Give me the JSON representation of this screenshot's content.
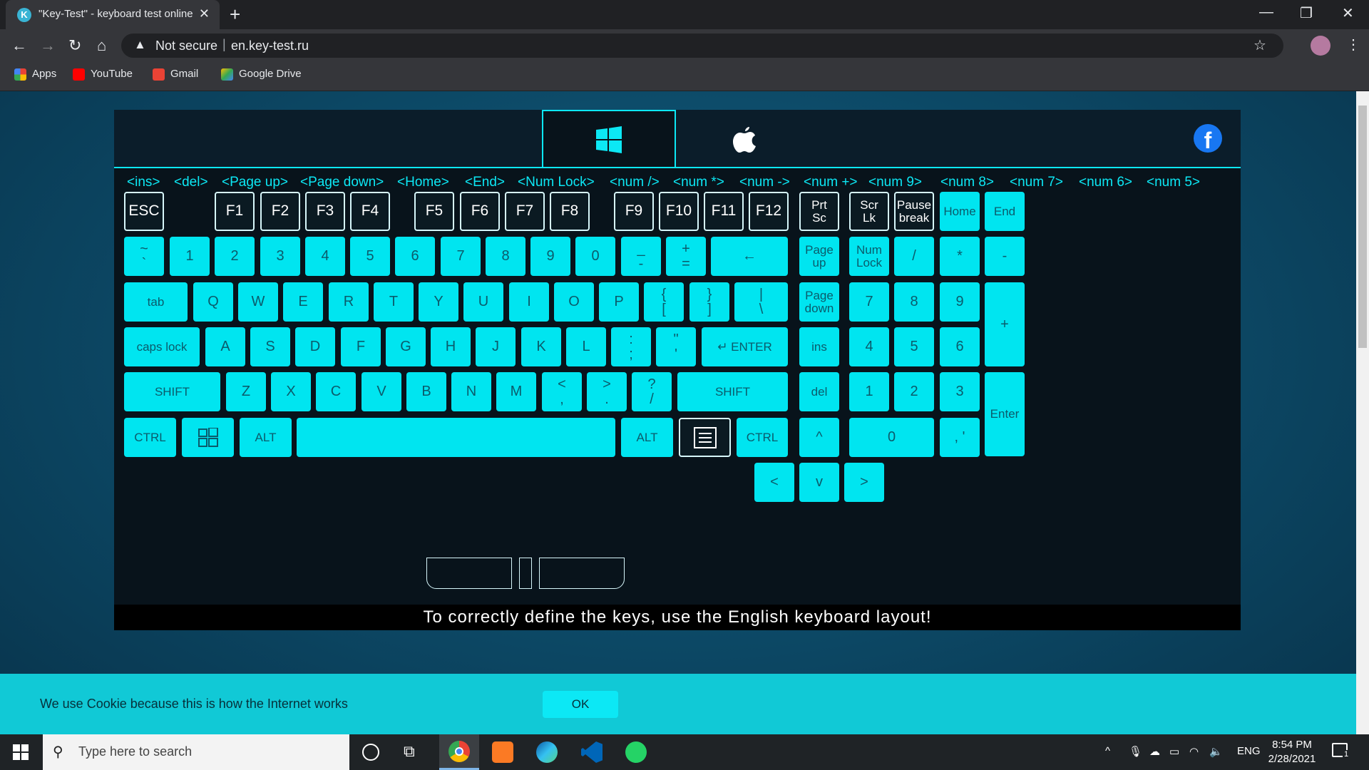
{
  "browser": {
    "tab_title": "\"Key-Test\" - keyboard test online",
    "tab_favicon": "K",
    "not_secure": "Not secure",
    "url": "en.key-test.ru"
  },
  "bookmarks": [
    {
      "label": "Apps",
      "color": "#e94235"
    },
    {
      "label": "YouTube",
      "color": "#ff0000"
    },
    {
      "label": "Gmail",
      "color": "#c5221f"
    },
    {
      "label": "Google Drive",
      "color": "#34a853"
    }
  ],
  "key_names": [
    "<ins>",
    "<del>",
    "<Page up>",
    "<Page down>",
    "<Home>",
    "<End>",
    "<Num Lock>",
    "<num />",
    "<num *>",
    "<num ->",
    "<num +>",
    "<num 9>",
    "<num 8>",
    "<num 7>",
    "<num 6>",
    "<num 5>"
  ],
  "keys": {
    "esc": "ESC",
    "f1": "F1",
    "f2": "F2",
    "f3": "F3",
    "f4": "F4",
    "f5": "F5",
    "f6": "F6",
    "f7": "F7",
    "f8": "F8",
    "f9": "F9",
    "f10": "F10",
    "f11": "F11",
    "f12": "F12",
    "prtsc": "Prt\nSc",
    "scrlk": "Scr\nLk",
    "pause": "Pause\nbreak",
    "home": "Home",
    "end": "End",
    "tilde": "~\n`",
    "n1": "1",
    "n2": "2",
    "n3": "3",
    "n4": "4",
    "n5": "5",
    "n6": "6",
    "n7": "7",
    "n8": "8",
    "n9": "9",
    "n0": "0",
    "minus": "_\n-",
    "plus": "+\n=",
    "back": "←",
    "pageup": "Page\nup",
    "numlock": "Num\nLock",
    "kslash": "/",
    "kstar": "*",
    "kminus": "-",
    "tab": "tab",
    "q": "Q",
    "w": "W",
    "e": "E",
    "r": "R",
    "t": "T",
    "y": "Y",
    "u": "U",
    "i": "I",
    "o": "O",
    "p": "P",
    "lbr": "{\n[",
    "rbr": "}\n]",
    "bslash": "|\n\\",
    "pagedown": "Page\ndown",
    "k7": "7",
    "k8": "8",
    "k9": "9",
    "kplus": "+",
    "caps": "caps lock",
    "a": "A",
    "s": "S",
    "d": "D",
    "f": "F",
    "g": "G",
    "h": "H",
    "j": "J",
    "k": "K",
    "l": "L",
    "semi": ":\n;",
    "quote": "\"\n'",
    "enter": "↵ ENTER",
    "ins": "ins",
    "k4": "4",
    "k5": "5",
    "k6": "6",
    "lshift": "SHIFT",
    "z": "Z",
    "x": "X",
    "c": "C",
    "v": "V",
    "b": "B",
    "nn": "N",
    "m": "M",
    "comma": "<\n,",
    "period": ">\n.",
    "slash": "?\n/",
    "rshift": "SHIFT",
    "del": "del",
    "k1": "1",
    "k2": "2",
    "k3": "3",
    "kenter": "Enter",
    "lctrl": "CTRL",
    "lalt": "ALT",
    "ralt": "ALT",
    "rctrl": "CTRL",
    "up": "^",
    "k0": "0",
    "kdot": ", '",
    "left": "<",
    "down": "v",
    "right": ">"
  },
  "notice": "To correctly define the keys, use the English keyboard layout!",
  "cookie": {
    "text": "We use Cookie because this is how the Internet works",
    "ok": "OK"
  },
  "taskbar": {
    "search_placeholder": "Type here to search",
    "lang": "ENG",
    "time": "8:54 PM",
    "date": "2/28/2021",
    "notif_count": "1"
  }
}
